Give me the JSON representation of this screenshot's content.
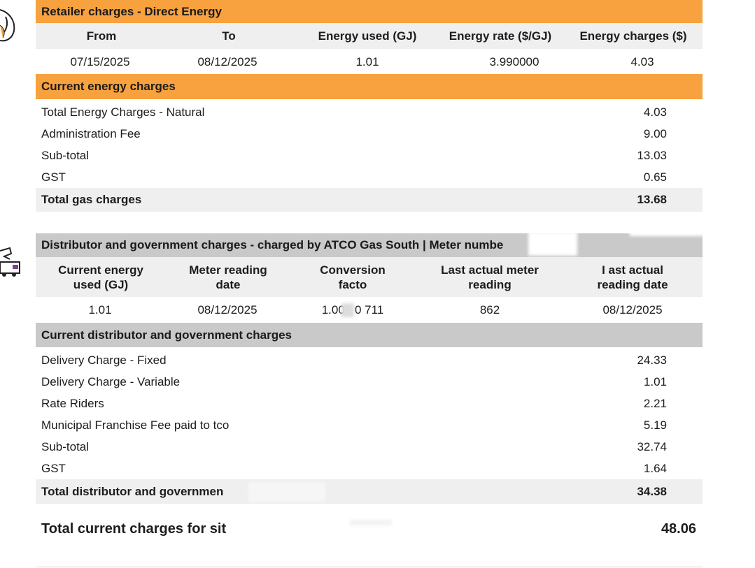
{
  "retailer": {
    "title": "Retailer charges - Direct Energy",
    "headers": [
      "From",
      "To",
      "Energy used (GJ)",
      "Energy rate ($/GJ)",
      "Energy charges ($)"
    ],
    "row": [
      "07/15/2025",
      "08/12/2025",
      "1.01",
      "3.990000",
      "4.03"
    ]
  },
  "current_energy": {
    "title": "Current energy charges",
    "lines": [
      {
        "label": "Total Energy Charges - Natural",
        "value": "4.03"
      },
      {
        "label": "Administration Fee",
        "value": "9.00"
      },
      {
        "label": "Sub-total",
        "value": "13.03"
      },
      {
        "label": "GST",
        "value": "0.65"
      }
    ],
    "total": {
      "label": "Total gas charges",
      "value": "13.68"
    }
  },
  "distributor": {
    "title": "Distributor and government charges - charged by  ATCO Gas South | Meter numbe",
    "headers": [
      [
        "Current energy",
        "used (GJ)"
      ],
      [
        "Meter reading",
        "date"
      ],
      [
        "Conversion",
        "facto"
      ],
      [
        "Last actual meter",
        "reading"
      ],
      [
        "I ast actual",
        "reading date"
      ]
    ],
    "row": [
      "1.01",
      "08/12/2025",
      "1.000  0  711",
      "862",
      "08/12/2025"
    ]
  },
  "current_distributor": {
    "title": "Current distributor and government charges",
    "lines": [
      {
        "label": "Delivery Charge - Fixed",
        "value": "24.33"
      },
      {
        "label": "Delivery Charge - Variable",
        "value": "1.01"
      },
      {
        "label": "Rate Riders",
        "value": "2.21"
      },
      {
        "label": "Municipal Franchise Fee paid to  tco",
        "value": "5.19"
      },
      {
        "label": "Sub-total",
        "value": "32.74"
      },
      {
        "label": "GST",
        "value": "1.64"
      }
    ],
    "total": {
      "label": "Total distributor and governmen",
      "value": "34.38"
    }
  },
  "grand_total": {
    "label": "Total current charges for sit",
    "value": "48.06"
  },
  "colors": {
    "orange": "#f7a23e",
    "grey": "#c9c9c9",
    "light_row": "#efefef"
  },
  "icons": [
    "logo-fragment-icon",
    "truck-fragment-icon"
  ]
}
